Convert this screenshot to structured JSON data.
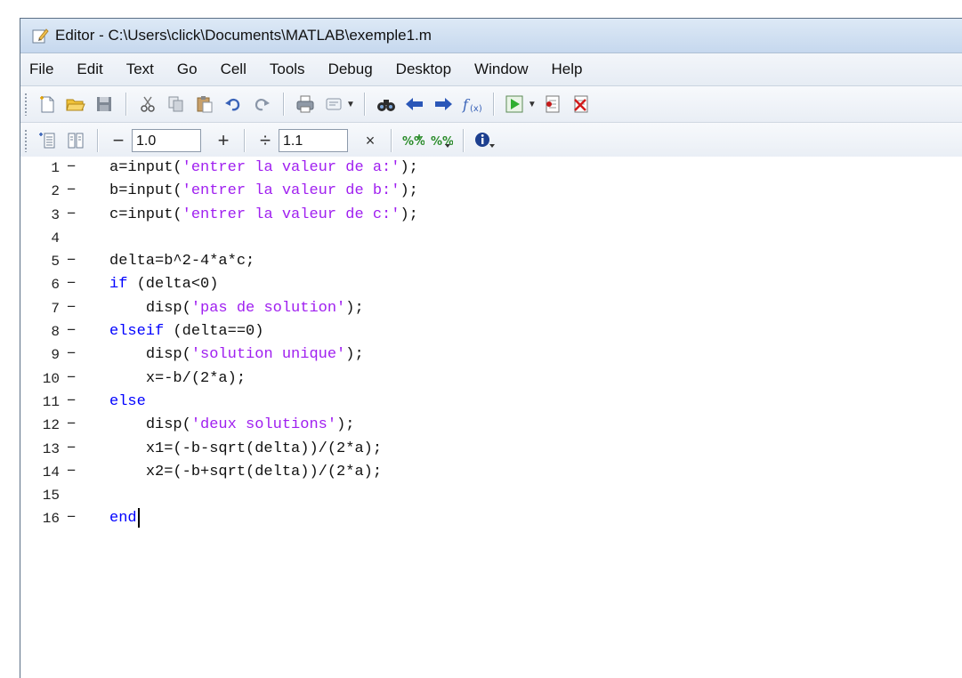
{
  "window": {
    "title": "Editor - C:\\Users\\click\\Documents\\MATLAB\\exemple1.m"
  },
  "menu": [
    "File",
    "Edit",
    "Text",
    "Go",
    "Cell",
    "Tools",
    "Debug",
    "Desktop",
    "Window",
    "Help"
  ],
  "cell_toolbar": {
    "minus_label": "−",
    "value1": "1.0",
    "plus_label": "+",
    "divide_label": "÷",
    "value2": "1.1",
    "times_label": "×"
  },
  "editor": {
    "lines": [
      {
        "num": "1",
        "mark": "−",
        "indent": "",
        "code": [
          {
            "t": "a=input(",
            "k": "code"
          },
          {
            "t": "'entrer la valeur de a:'",
            "k": "str"
          },
          {
            "t": ");",
            "k": "code"
          }
        ]
      },
      {
        "num": "2",
        "mark": "−",
        "indent": "",
        "code": [
          {
            "t": "b=input(",
            "k": "code"
          },
          {
            "t": "'entrer la valeur de b:'",
            "k": "str"
          },
          {
            "t": ");",
            "k": "code"
          }
        ]
      },
      {
        "num": "3",
        "mark": "−",
        "indent": "",
        "code": [
          {
            "t": "c=input(",
            "k": "code"
          },
          {
            "t": "'entrer la valeur de c:'",
            "k": "str"
          },
          {
            "t": ");",
            "k": "code"
          }
        ]
      },
      {
        "num": "4",
        "mark": "",
        "indent": "",
        "code": []
      },
      {
        "num": "5",
        "mark": "−",
        "indent": "",
        "code": [
          {
            "t": "delta=b^2-4*a*c;",
            "k": "code"
          }
        ]
      },
      {
        "num": "6",
        "mark": "−",
        "indent": "",
        "code": [
          {
            "t": "if",
            "k": "kw"
          },
          {
            "t": " (delta<0)",
            "k": "code"
          }
        ]
      },
      {
        "num": "7",
        "mark": "−",
        "indent": "    ",
        "code": [
          {
            "t": "disp(",
            "k": "code"
          },
          {
            "t": "'pas de solution'",
            "k": "str"
          },
          {
            "t": ");",
            "k": "code"
          }
        ]
      },
      {
        "num": "8",
        "mark": "−",
        "indent": "",
        "code": [
          {
            "t": "elseif",
            "k": "kw"
          },
          {
            "t": " (delta==0)",
            "k": "code"
          }
        ]
      },
      {
        "num": "9",
        "mark": "−",
        "indent": "    ",
        "code": [
          {
            "t": "disp(",
            "k": "code"
          },
          {
            "t": "'solution unique'",
            "k": "str"
          },
          {
            "t": ");",
            "k": "code"
          }
        ]
      },
      {
        "num": "10",
        "mark": "−",
        "indent": "    ",
        "code": [
          {
            "t": "x=-b/(2*a);",
            "k": "code"
          }
        ]
      },
      {
        "num": "11",
        "mark": "−",
        "indent": "",
        "code": [
          {
            "t": "else",
            "k": "kw"
          }
        ]
      },
      {
        "num": "12",
        "mark": "−",
        "indent": "    ",
        "code": [
          {
            "t": "disp(",
            "k": "code"
          },
          {
            "t": "'deux solutions'",
            "k": "str"
          },
          {
            "t": ");",
            "k": "code"
          }
        ]
      },
      {
        "num": "13",
        "mark": "−",
        "indent": "    ",
        "code": [
          {
            "t": "x1=(-b-sqrt(delta))/(2*a);",
            "k": "code"
          }
        ]
      },
      {
        "num": "14",
        "mark": "−",
        "indent": "    ",
        "code": [
          {
            "t": "x2=(-b+sqrt(delta))/(2*a);",
            "k": "code"
          }
        ]
      },
      {
        "num": "15",
        "mark": "",
        "indent": "",
        "code": []
      },
      {
        "num": "16",
        "mark": "−",
        "indent": "",
        "code": [
          {
            "t": "end",
            "k": "kw"
          }
        ]
      }
    ]
  },
  "colors": {
    "string": "#a020f0",
    "keyword": "#0000ff",
    "run_green": "#2fae2f"
  }
}
